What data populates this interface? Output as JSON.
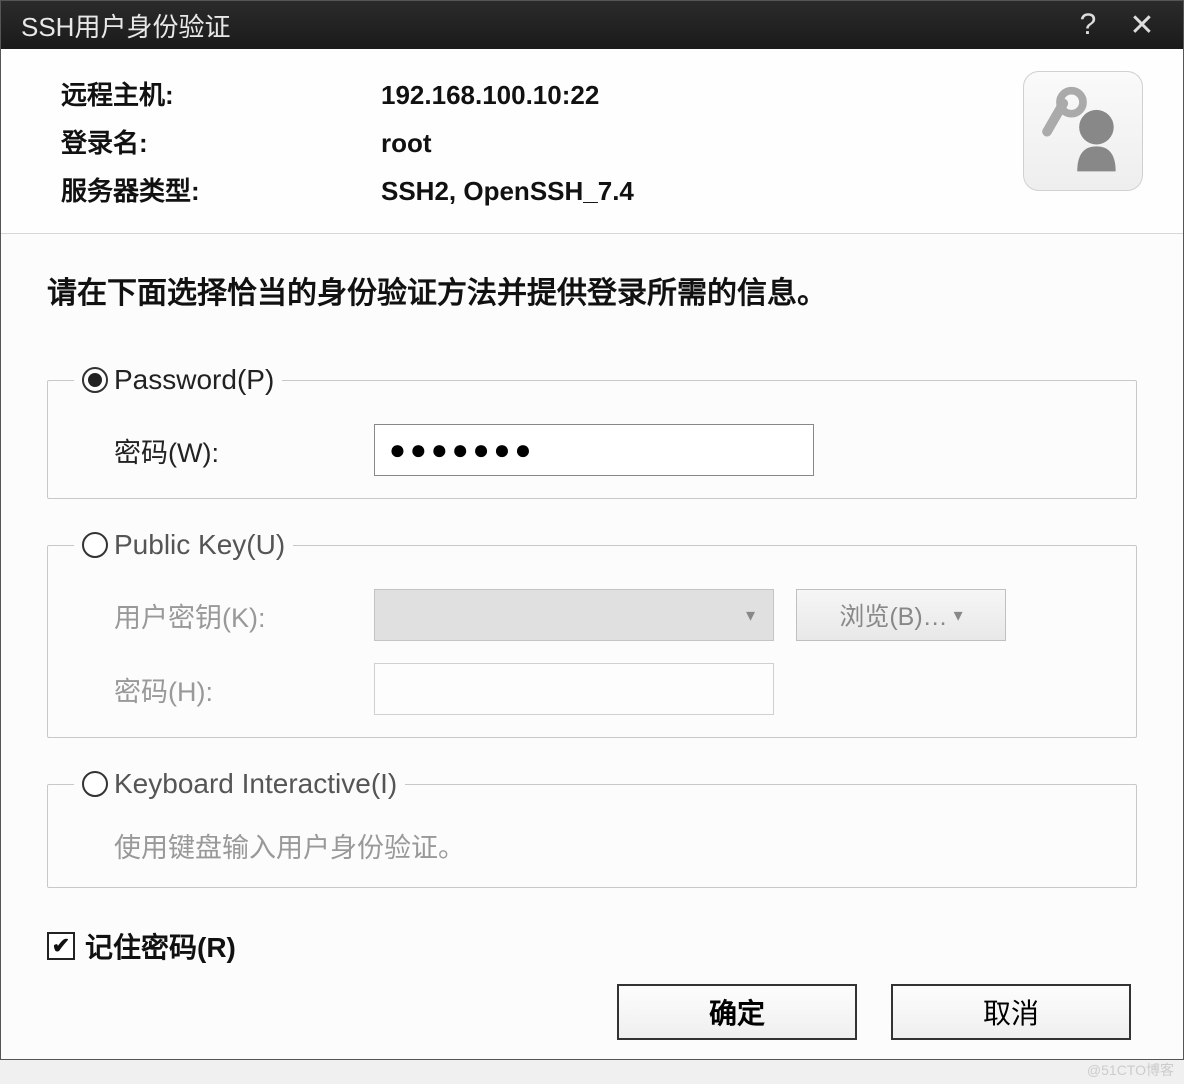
{
  "titlebar": {
    "title": "SSH用户身份验证",
    "help_icon": "?",
    "close_icon": "✕"
  },
  "info": {
    "host_label": "远程主机:",
    "host_value": "192.168.100.10:22",
    "login_label": "登录名:",
    "login_value": "root",
    "server_label": "服务器类型:",
    "server_value": "SSH2, OpenSSH_7.4"
  },
  "prompt": "请在下面选择恰当的身份验证方法并提供登录所需的信息。",
  "password_group": {
    "label": "Password(P)",
    "field_label": "密码(W):",
    "value": "●●●●●●●"
  },
  "publickey_group": {
    "label": "Public Key(U)",
    "key_label": "用户密钥(K):",
    "browse_label": "浏览(B)…",
    "pass_label": "密码(H):"
  },
  "ki_group": {
    "label": "Keyboard Interactive(I)",
    "desc": "使用键盘输入用户身份验证。"
  },
  "remember_label": "记住密码(R)",
  "buttons": {
    "ok": "确定",
    "cancel": "取消"
  },
  "watermark": "@51CTO博客"
}
